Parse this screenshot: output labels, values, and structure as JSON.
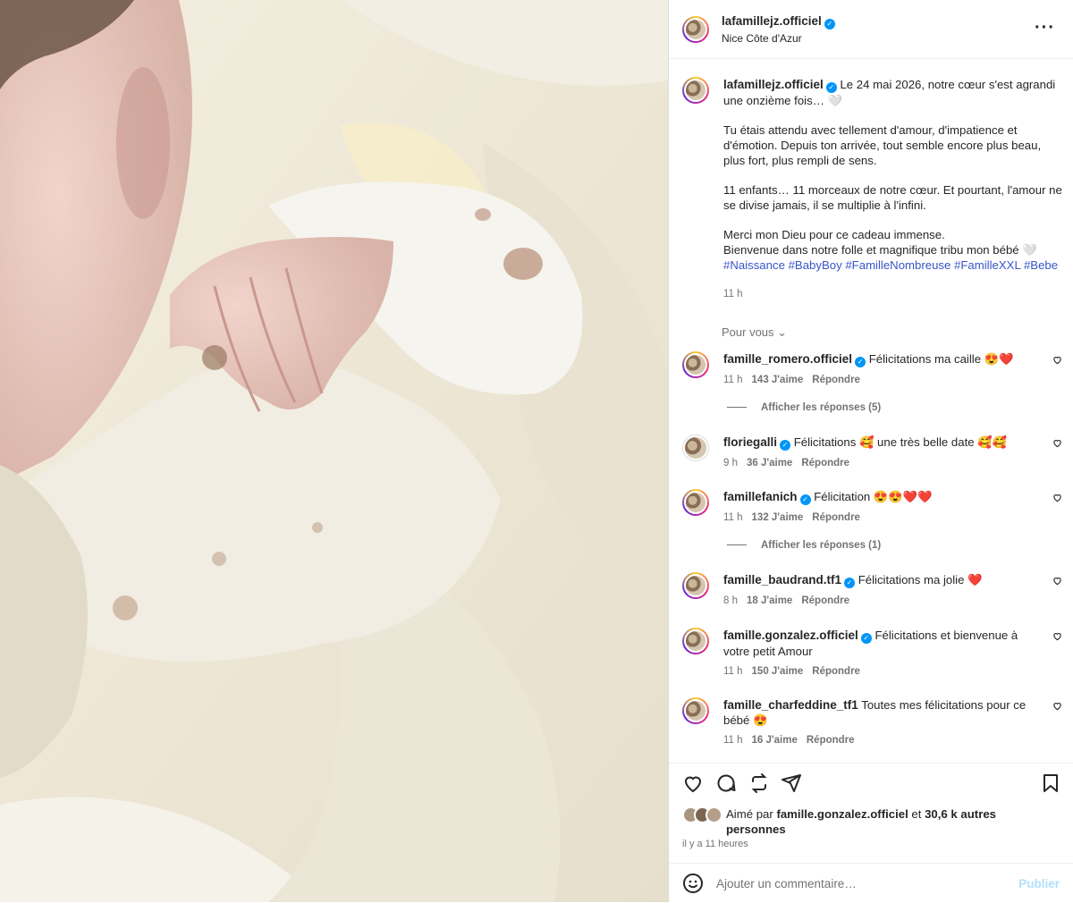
{
  "post": {
    "username": "lafamillejz.officiel",
    "location": "Nice Côte d'Azur",
    "caption": {
      "line1": "Le 24 mai 2026, notre cœur s'est agrandi une onzième fois… 🤍",
      "p2": "Tu étais attendu avec tellement d'amour, d'impatience et d'émotion. Depuis ton arrivée, tout semble encore plus beau, plus fort, plus rempli de sens.",
      "p3": "11 enfants… 11 morceaux de notre cœur. Et pourtant, l'amour ne se divise jamais, il se multiplie à l'infini.",
      "p4a": "Merci mon Dieu pour ce cadeau immense.",
      "p4b": "Bienvenue dans notre folle et magnifique tribu mon bébé 🤍",
      "tags": "#Naissance #BabyBoy #FamilleNombreuse #FamilleXXL #Bebe",
      "time": "11 h"
    },
    "pour_vous": "Pour vous ⌄"
  },
  "comments": [
    {
      "user": "famille_romero.officiel",
      "text": "Félicitations ma caille 😍❤️",
      "time": "11 h",
      "likes": "143 J'aime",
      "reply": "Répondre",
      "replies": "Afficher les réponses (5)"
    },
    {
      "user": "floriegalli",
      "text": "Félicitations 🥰 une très belle date 🥰🥰",
      "time": "9 h",
      "likes": "36 J'aime",
      "reply": "Répondre"
    },
    {
      "user": "famillefanich",
      "text": "Félicitation 😍😍❤️❤️",
      "time": "11 h",
      "likes": "132 J'aime",
      "reply": "Répondre",
      "replies": "Afficher les réponses (1)"
    },
    {
      "user": "famille_baudrand.tf1",
      "text": "Félicitations ma jolie ❤️",
      "time": "8 h",
      "likes": "18 J'aime",
      "reply": "Répondre"
    },
    {
      "user": "famille.gonzalez.officiel",
      "text": "Félicitations et bienvenue à votre petit Amour",
      "time": "11 h",
      "likes": "150 J'aime",
      "reply": "Répondre"
    },
    {
      "user": "famille_charfeddine_tf1",
      "text": "Toutes mes félicitations pour ce bébé 😍",
      "time": "11 h",
      "likes": "16 J'aime",
      "reply": "Répondre"
    }
  ],
  "footer": {
    "liked_prefix": "Aimé par",
    "liked_user": "famille.gonzalez.officiel",
    "liked_and": "et",
    "liked_others": "30,6 k autres personnes",
    "ago": "il y a 11 heures",
    "comment_placeholder": "Ajouter un commentaire…",
    "publish": "Publier"
  },
  "icons": {
    "verified": "verified-badge-icon",
    "more": "more-options-icon",
    "like": "heart-icon",
    "comment": "comment-icon",
    "repost": "repost-icon",
    "share": "share-icon",
    "save": "bookmark-icon",
    "emoji": "emoji-icon"
  },
  "colors": {
    "link": "#3955c7",
    "verified": "#0095f6",
    "muted": "#737373",
    "publish": "#b2dffc"
  }
}
